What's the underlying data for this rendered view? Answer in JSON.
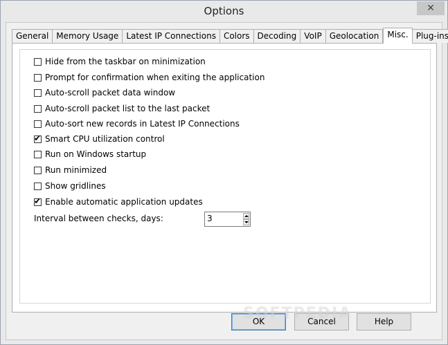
{
  "window": {
    "title": "Options",
    "close_glyph": "✕"
  },
  "tabs": [
    {
      "label": "General",
      "active": false
    },
    {
      "label": "Memory Usage",
      "active": false
    },
    {
      "label": "Latest IP Connections",
      "active": false
    },
    {
      "label": "Colors",
      "active": false
    },
    {
      "label": "Decoding",
      "active": false
    },
    {
      "label": "VoIP",
      "active": false
    },
    {
      "label": "Geolocation",
      "active": false
    },
    {
      "label": "Misc.",
      "active": true
    },
    {
      "label": "Plug-ins",
      "active": false
    }
  ],
  "options": [
    {
      "label": "Hide from the taskbar on minimization",
      "checked": false
    },
    {
      "label": "Prompt for confirmation when exiting the application",
      "checked": false
    },
    {
      "label": "Auto-scroll packet data window",
      "checked": false
    },
    {
      "label": "Auto-scroll packet list to the last packet",
      "checked": false
    },
    {
      "label": "Auto-sort new records in Latest IP Connections",
      "checked": false
    },
    {
      "label": "Smart CPU utilization control",
      "checked": true
    },
    {
      "label": "Run on Windows startup",
      "checked": false
    },
    {
      "label": "Run minimized",
      "checked": false
    },
    {
      "label": "Show gridlines",
      "checked": false
    },
    {
      "label": "Enable automatic application updates",
      "checked": true
    }
  ],
  "interval": {
    "label": "Interval between checks, days:",
    "value": "3"
  },
  "buttons": {
    "ok": "OK",
    "cancel": "Cancel",
    "help": "Help"
  },
  "watermark": "SOFTPEDIA",
  "check_glyph": "✔"
}
